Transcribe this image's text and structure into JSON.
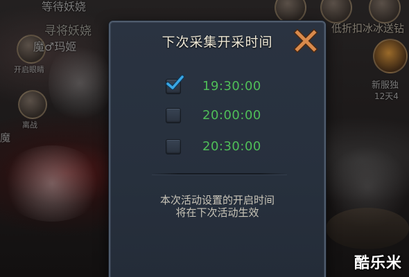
{
  "dialog": {
    "title": "下次采集开采时间",
    "options": [
      {
        "time": "19:30:00",
        "checked": true
      },
      {
        "time": "20:00:00",
        "checked": false
      },
      {
        "time": "20:30:00",
        "checked": false
      }
    ],
    "notice_line1": "本次活动设置的开启时间",
    "notice_line2": "将在下次活动生效",
    "accent_color": "#4fbe58",
    "check_color": "#3aa7e6",
    "close_color": "#d98a4c"
  },
  "background": {
    "texts": [
      "等待妖娆",
      "寻将妖娆",
      "魔♂玛姬",
      "开启眼睛",
      "离战",
      "魔",
      "低折扣冰冰送钻",
      "新服独",
      "12天4"
    ]
  },
  "watermark": "酷乐米"
}
